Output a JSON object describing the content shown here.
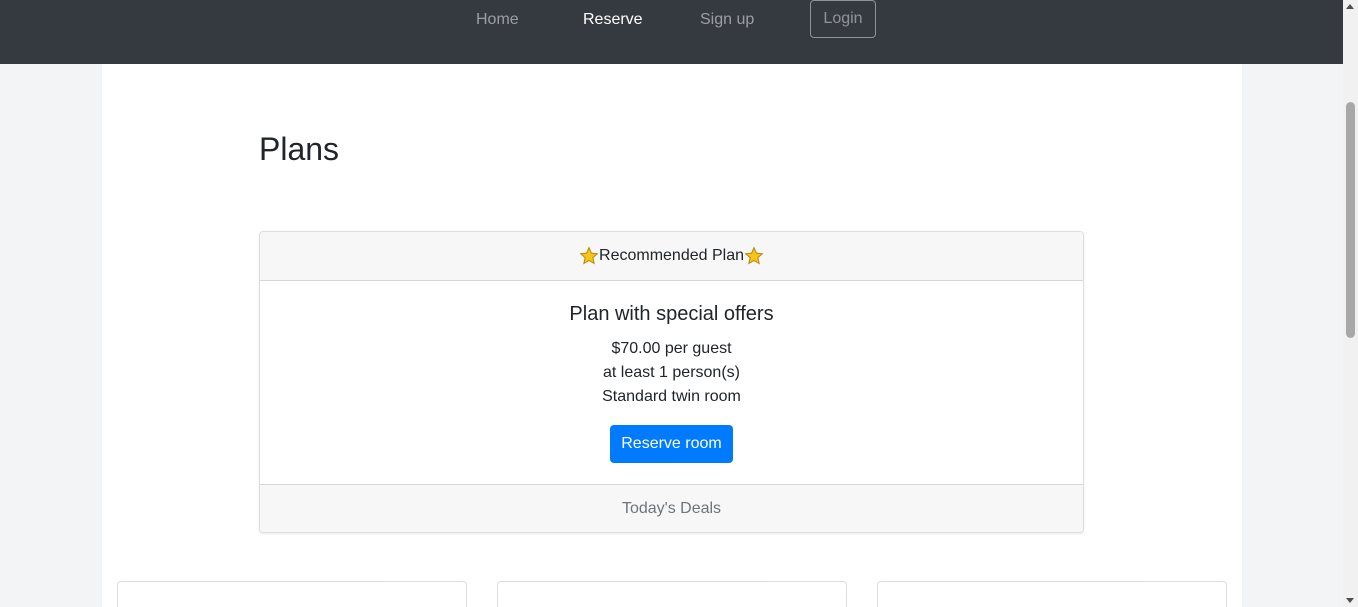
{
  "nav": {
    "home": "Home",
    "reserve": "Reserve",
    "signup": "Sign up",
    "login": "Login"
  },
  "page": {
    "title": "Plans"
  },
  "recommended": {
    "header": "Recommended Plan",
    "header_icon": "star-icon",
    "plan_name": "Plan with special offers",
    "price": "$70.00 per guest",
    "min_people": "at least 1 person(s)",
    "room_type": "Standard twin room",
    "button_label": "Reserve room",
    "footer": "Today's Deals"
  },
  "colors": {
    "navbar": "#343a40",
    "primary": "#007bff",
    "star": "#f5c518"
  }
}
